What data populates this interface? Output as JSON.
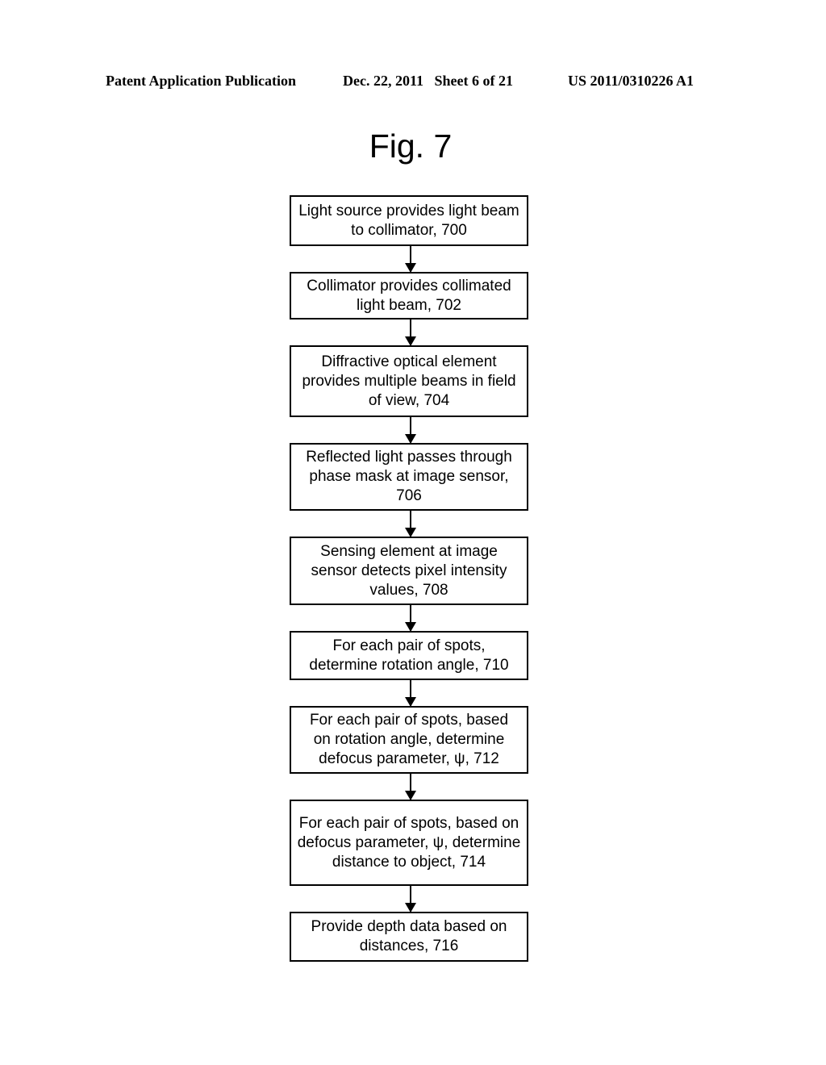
{
  "header": {
    "left": "Patent Application Publication",
    "middle": "Dec. 22, 2011   Sheet 6 of 21",
    "right": "US 2011/0310226 A1"
  },
  "figure": {
    "title": "Fig. 7",
    "steps": [
      {
        "id": "700",
        "text": "Light source provides light beam to collimator, 700"
      },
      {
        "id": "702",
        "text": "Collimator provides collimated light beam, 702"
      },
      {
        "id": "704",
        "text": "Diffractive optical element provides multiple beams in field of view, 704"
      },
      {
        "id": "706",
        "text": "Reflected light passes through phase mask at image sensor, 706"
      },
      {
        "id": "708",
        "text": "Sensing element at image sensor detects pixel intensity values, 708"
      },
      {
        "id": "710",
        "text": "For each pair of spots, determine rotation angle, 710"
      },
      {
        "id": "712",
        "text": "For each pair of spots, based on rotation angle, determine defocus parameter, ψ, 712"
      },
      {
        "id": "714",
        "text": "For each pair of spots, based on defocus parameter, ψ, determine distance to object, 714"
      },
      {
        "id": "716",
        "text": "Provide depth data based on distances, 716"
      }
    ]
  }
}
